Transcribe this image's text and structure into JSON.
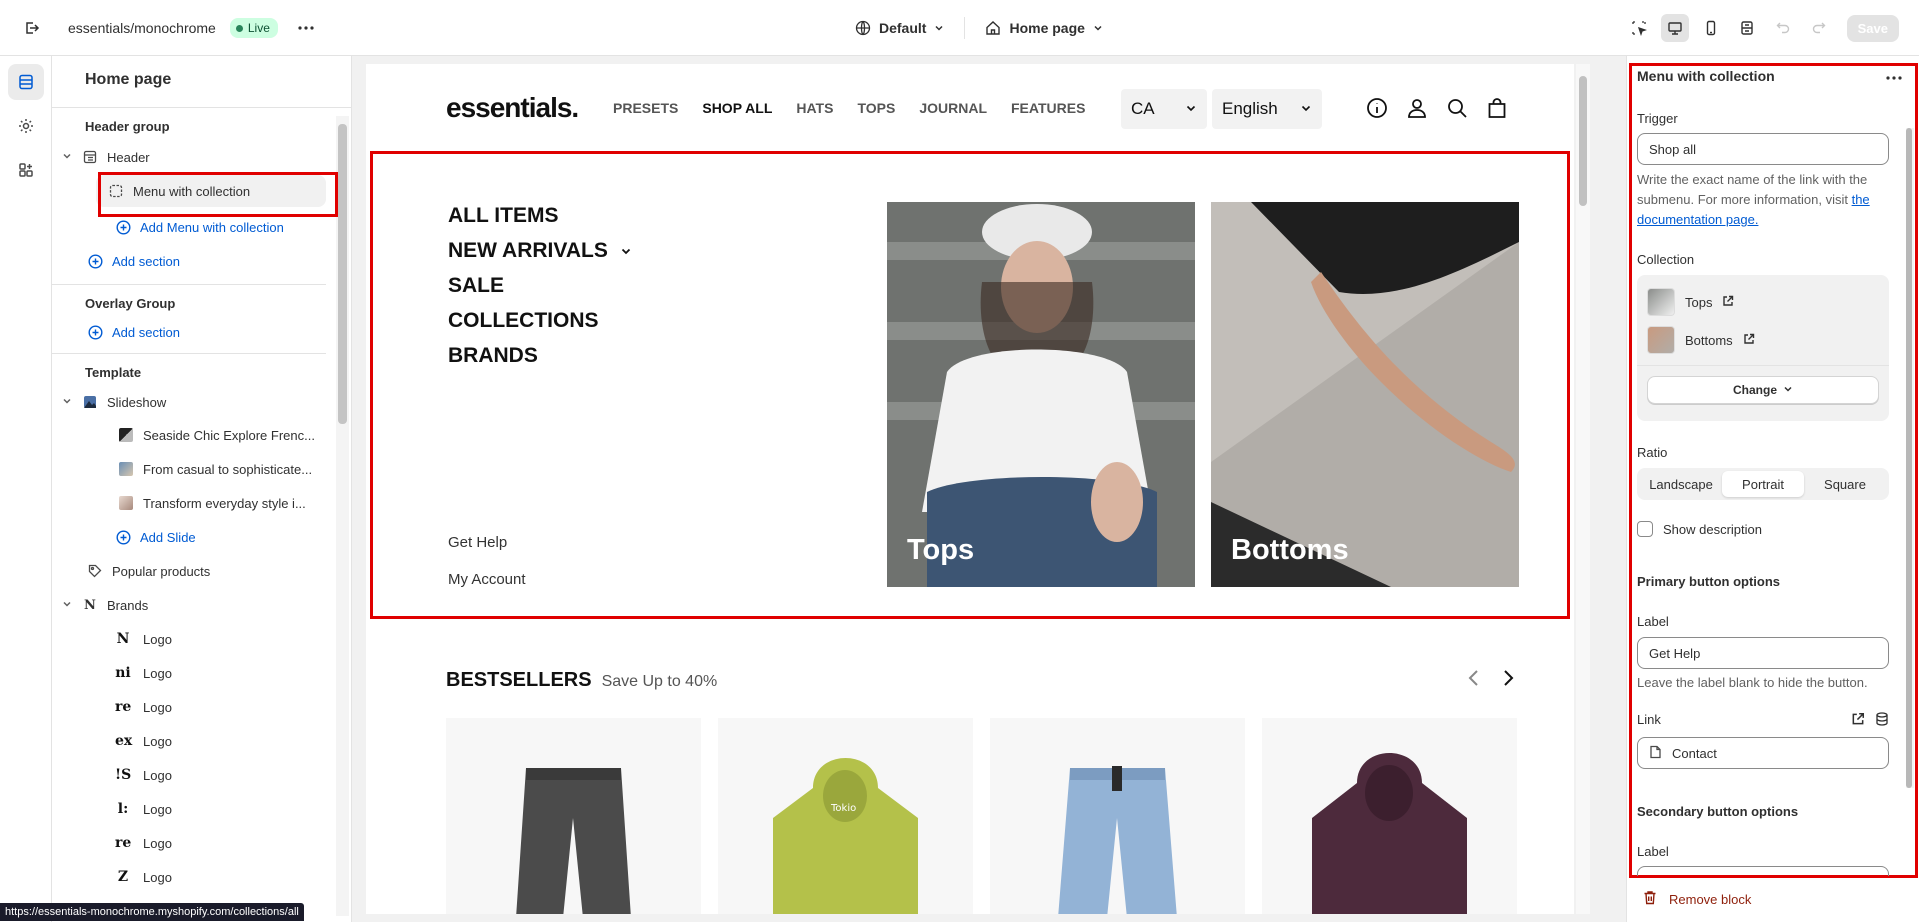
{
  "topbar": {
    "store_name": "essentials/monochrome",
    "live_label": "Live",
    "theme_select": "Default",
    "page_select": "Home page",
    "save_label": "Save"
  },
  "sidebar": {
    "title": "Home page",
    "header_group": {
      "label": "Header group",
      "header": "Header",
      "menu_block": "Menu with collection",
      "add_block": "Add Menu with collection",
      "add_section": "Add section"
    },
    "overlay_group": {
      "label": "Overlay Group",
      "add_section": "Add section"
    },
    "template": {
      "label": "Template",
      "slideshow": "Slideshow",
      "slides": [
        "Seaside Chic Explore Frenc...",
        "From casual to sophisticate...",
        "Transform everyday style i..."
      ],
      "add_slide": "Add Slide",
      "popular_products": "Popular products",
      "brands": "Brands",
      "logos": [
        {
          "glyph": "N",
          "label": "Logo"
        },
        {
          "glyph": "ni",
          "label": "Logo"
        },
        {
          "glyph": "re",
          "label": "Logo"
        },
        {
          "glyph": "ex",
          "label": "Logo"
        },
        {
          "glyph": "!S",
          "label": "Logo"
        },
        {
          "glyph": "l:",
          "label": "Logo"
        },
        {
          "glyph": "re",
          "label": "Logo"
        },
        {
          "glyph": "Z",
          "label": "Logo"
        }
      ]
    }
  },
  "status_url": "https://essentials-monochrome.myshopify.com/collections/all",
  "site": {
    "logo": "essentials.",
    "nav": [
      "PRESETS",
      "SHOP ALL",
      "HATS",
      "TOPS",
      "JOURNAL",
      "FEATURES"
    ],
    "nav_current": "SHOP ALL",
    "country": "CA",
    "language": "English",
    "mega_menu": [
      "ALL ITEMS",
      "NEW ARRIVALS",
      "SALE",
      "COLLECTIONS",
      "BRANDS"
    ],
    "help_links": [
      "Get Help",
      "My Account"
    ],
    "cards": [
      "Tops",
      "Bottoms"
    ],
    "bestsellers_title": "BESTSELLERS",
    "bestsellers_sub": "Save Up to 40%"
  },
  "settings": {
    "title": "Menu with collection",
    "trigger_label": "Trigger",
    "trigger_value": "Shop all",
    "trigger_help": "Write the exact name of the link with the submenu. For more information, visit",
    "doc_link": "the documentation page.",
    "collection_label": "Collection",
    "collections": [
      "Tops",
      "Bottoms"
    ],
    "change_label": "Change",
    "ratio_label": "Ratio",
    "ratio_options": [
      "Landscape",
      "Portrait",
      "Square"
    ],
    "ratio_selected": "Portrait",
    "show_description": "Show description",
    "primary_heading": "Primary button options",
    "label_label": "Label",
    "primary_label_value": "Get Help",
    "label_help": "Leave the label blank to hide the button.",
    "link_label": "Link",
    "link_value": "Contact",
    "secondary_heading": "Secondary button options",
    "secondary_label_label": "Label",
    "remove_block": "Remove block"
  },
  "colors": {
    "accent": "#005bd3",
    "highlight": "#e00000",
    "live_bg": "#cdfee1"
  }
}
